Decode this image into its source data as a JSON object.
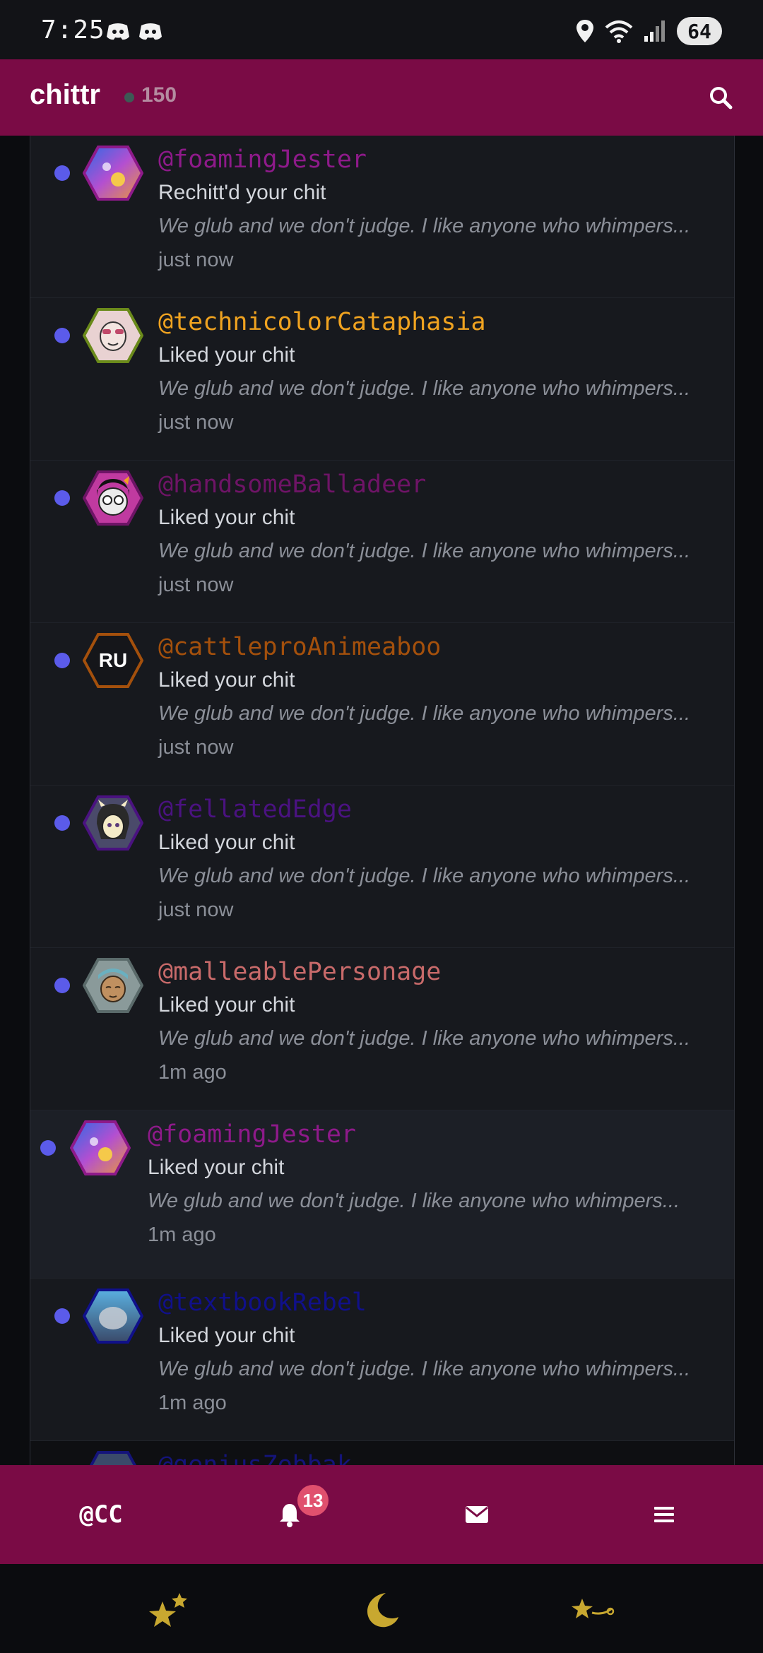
{
  "status_bar": {
    "time": "7:25",
    "battery": "64"
  },
  "header": {
    "title": "chittr",
    "online_count": "150"
  },
  "notifications": [
    {
      "user": "@foamingJester",
      "user_color": "#8e1a8a",
      "action": "Rechitt'd your chit",
      "excerpt": "We glub and we don't judge. I like anyone who whimpers...",
      "time": "just now"
    },
    {
      "user": "@technicolorCataphasia",
      "user_color": "#f0a320",
      "action": "Liked your chit",
      "excerpt": "We glub and we don't judge. I like anyone who whimpers...",
      "time": "just now"
    },
    {
      "user": "@handsomeBalladeer",
      "user_color": "#6e1466",
      "action": "Liked your chit",
      "excerpt": "We glub and we don't judge. I like anyone who whimpers...",
      "time": "just now"
    },
    {
      "user": "@cattleproAnimeaboo",
      "user_color": "#a4500c",
      "action": "Liked your chit",
      "excerpt": "We glub and we don't judge. I like anyone who whimpers...",
      "time": "just now",
      "avatar_initials": "RU"
    },
    {
      "user": "@fellatedEdge",
      "user_color": "#4a1280",
      "action": "Liked your chit",
      "excerpt": "We glub and we don't judge. I like anyone who whimpers...",
      "time": "just now"
    },
    {
      "user": "@malleablePersonage",
      "user_color": "#c86a6a",
      "action": "Liked your chit",
      "excerpt": "We glub and we don't judge. I like anyone who whimpers...",
      "time": "1m ago"
    },
    {
      "user": "@foamingJester",
      "user_color": "#8e1a8a",
      "action": "Liked your chit",
      "excerpt": "We glub and we don't judge. I like anyone who whimpers...",
      "time": "1m ago"
    },
    {
      "user": "@textbookRebel",
      "user_color": "#10108a",
      "action": "Liked your chit",
      "excerpt": "We glub and we don't judge. I like anyone who whimpers...",
      "time": "1m ago"
    },
    {
      "user": "@geniusZebbak",
      "user_color": "#14147a"
    }
  ],
  "bottom_nav": {
    "handle": "@CC",
    "notification_badge": "13"
  },
  "colors": {
    "header_bg": "#7a0b45",
    "feed_bg": "#17191e",
    "unread_dot": "#5b5bea",
    "badge": "#e0506e"
  },
  "icons": [
    "discord-icon",
    "location-icon",
    "wifi-icon",
    "signal-icon",
    "search-icon",
    "bell-icon",
    "mail-icon",
    "menu-icon",
    "stars-icon",
    "moon-icon",
    "shooting-star-icon"
  ]
}
